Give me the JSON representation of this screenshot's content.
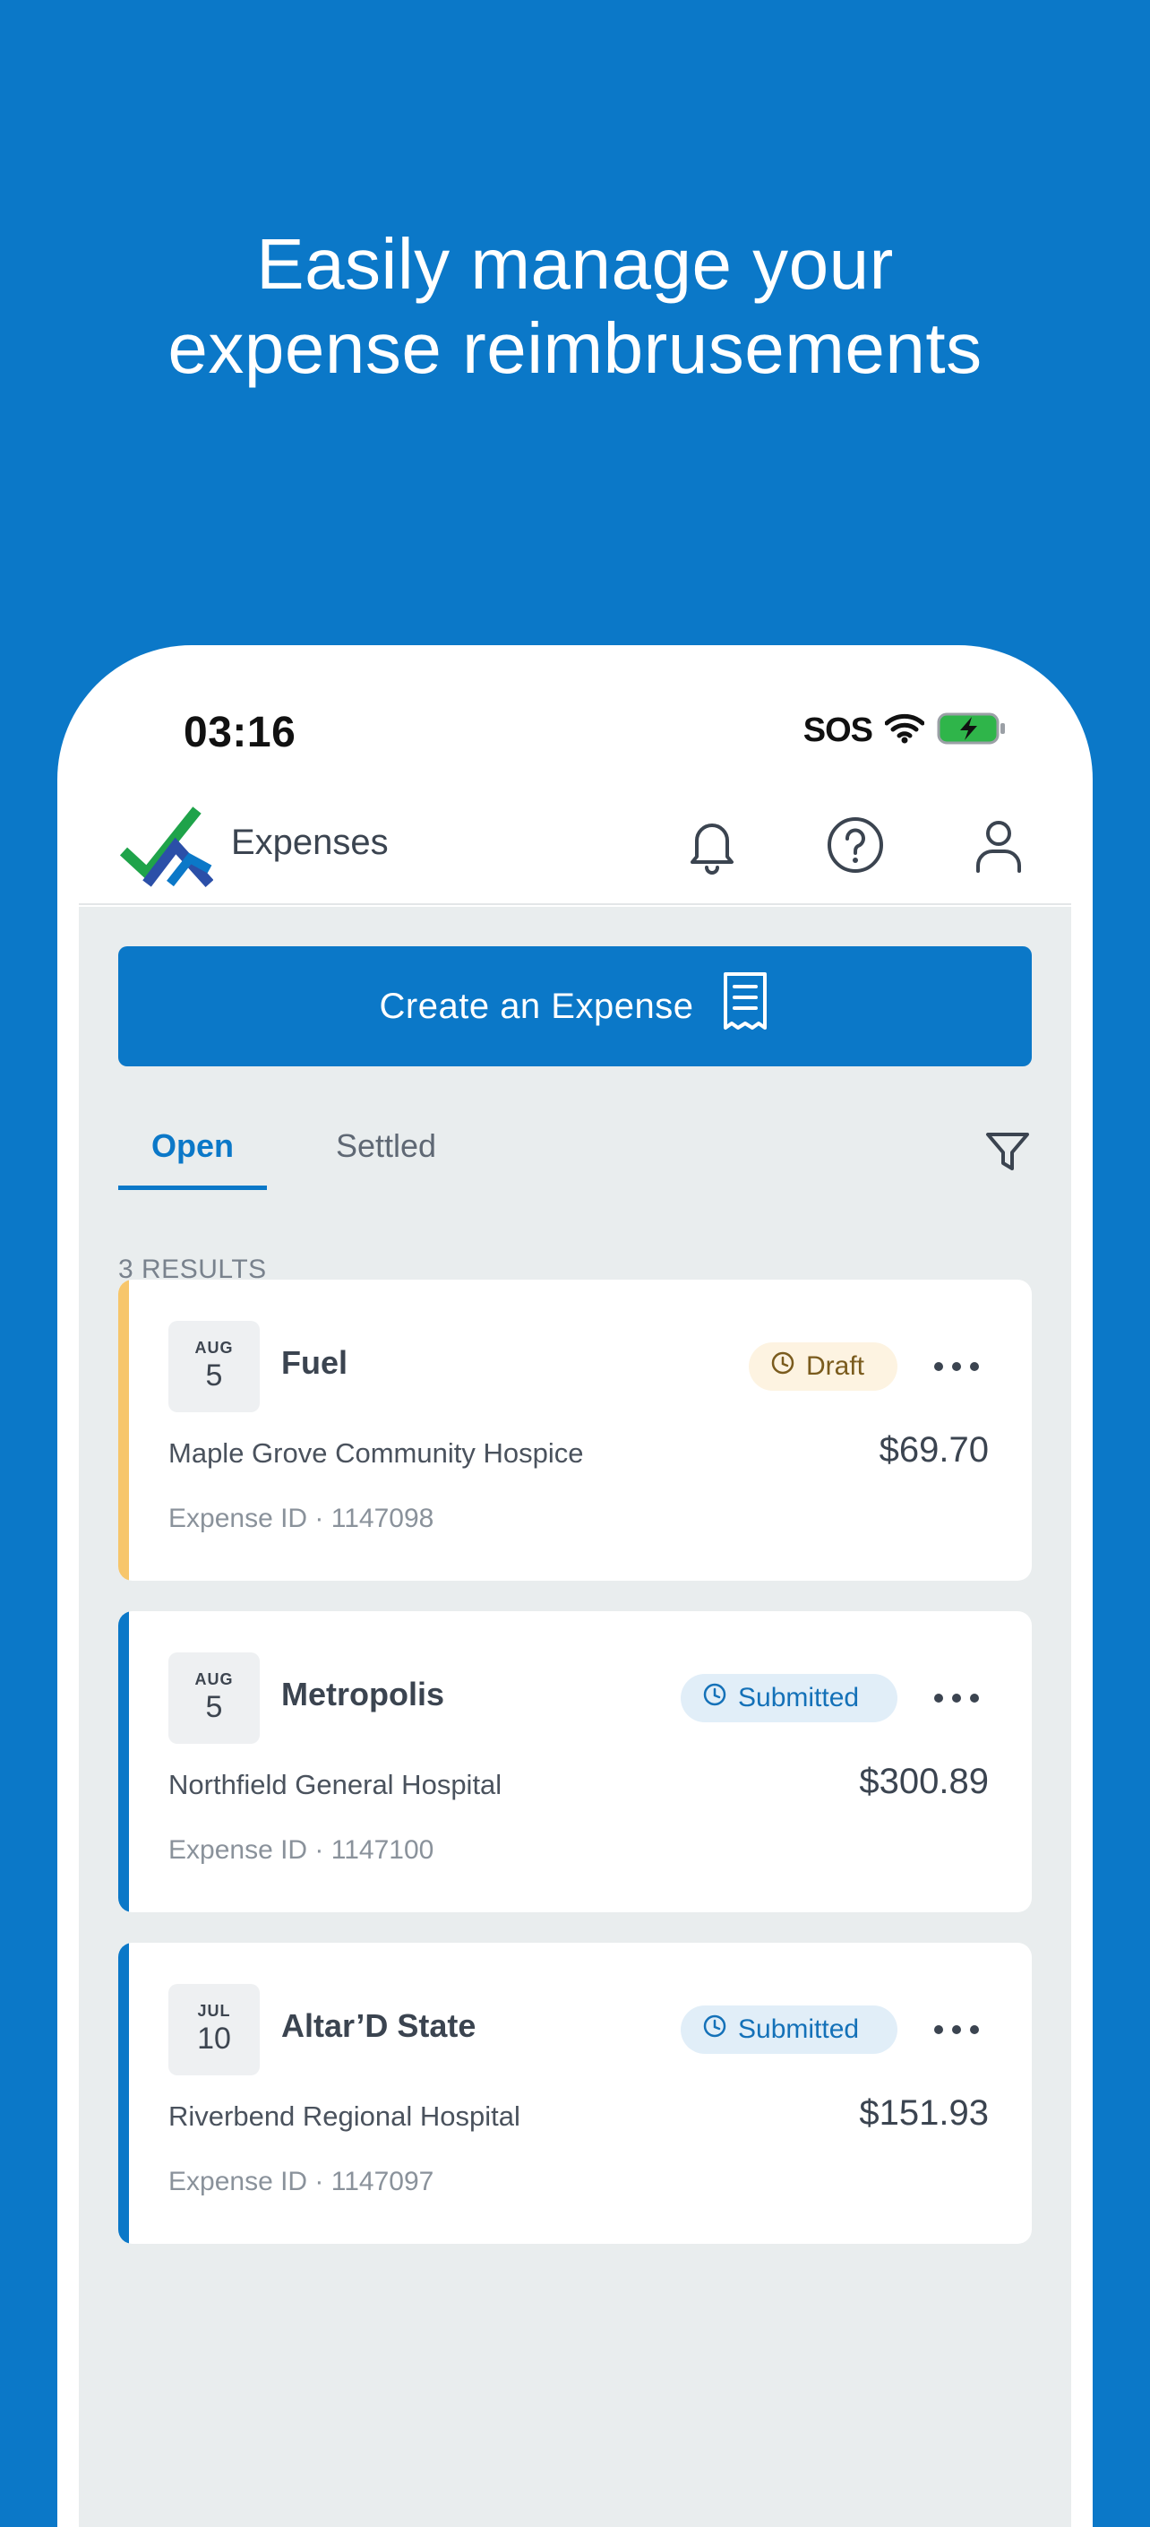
{
  "headline": {
    "line1": "Easily manage your",
    "line2": "expense reimbrusements"
  },
  "status_bar": {
    "time": "03:16",
    "sos": "SOS",
    "icons": [
      "wifi-icon",
      "battery-charging-icon"
    ]
  },
  "header": {
    "app_name": "Expenses",
    "icons": [
      "logo-icon",
      "bell-icon",
      "help-icon",
      "profile-icon"
    ]
  },
  "create_button": {
    "label": "Create an Expense",
    "icon": "receipt-icon"
  },
  "tabs": [
    {
      "label": "Open",
      "active": true
    },
    {
      "label": "Settled",
      "active": false
    }
  ],
  "results_count": "3 RESULTS",
  "expenses": [
    {
      "month": "AUG",
      "day": "5",
      "title": "Fuel",
      "status": "Draft",
      "organization": "Maple Grove Community Hospice",
      "amount": "$69.70",
      "expense_id": "Expense ID · 1147098"
    },
    {
      "month": "AUG",
      "day": "5",
      "title": "Metropolis",
      "status": "Submitted",
      "organization": "Northfield General Hospital",
      "amount": "$300.89",
      "expense_id": "Expense ID · 1147100"
    },
    {
      "month": "JUL",
      "day": "10",
      "title": "Altar’D State",
      "status": "Submitted",
      "organization": "Riverbend Regional Hospital",
      "amount": "$151.93",
      "expense_id": "Expense ID · 1147097"
    }
  ],
  "colors": {
    "brand_blue": "#0B78C8",
    "draft_accent": "#F7C66B",
    "submitted_accent": "#0B78C8",
    "logo_green": "#1FA34A"
  }
}
